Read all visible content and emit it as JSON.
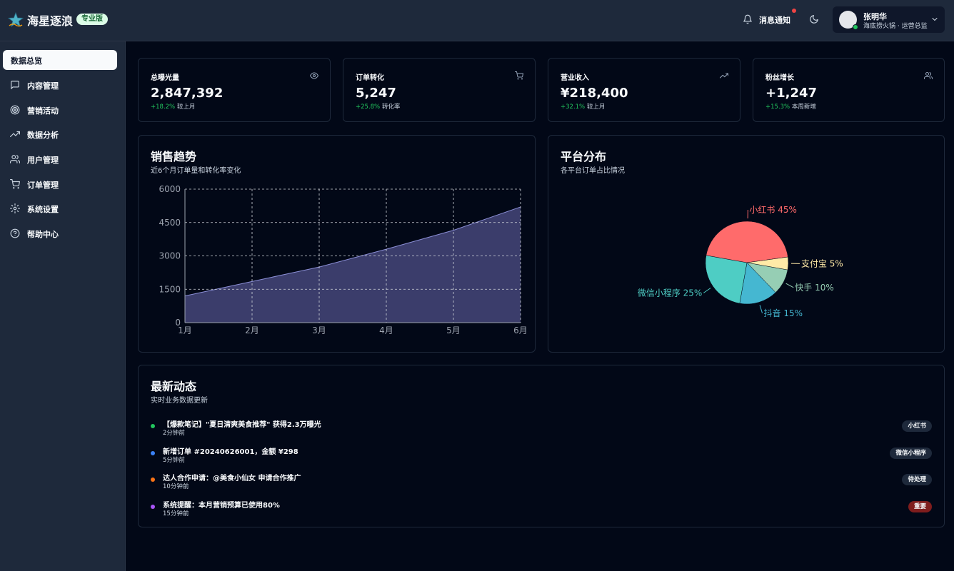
{
  "header": {
    "brand": "海星逐浪",
    "badge": "专业版",
    "notifications_label": "消息通知",
    "user": {
      "name": "张明华",
      "role": "海底捞火锅 · 运营总监"
    }
  },
  "sidebar": {
    "items": [
      {
        "label": "数据总览",
        "icon": "home-icon",
        "active": true
      },
      {
        "label": "内容管理",
        "icon": "message-square-icon"
      },
      {
        "label": "营销活动",
        "icon": "target-icon"
      },
      {
        "label": "数据分析",
        "icon": "trending-up-icon"
      },
      {
        "label": "用户管理",
        "icon": "users-icon"
      },
      {
        "label": "订单管理",
        "icon": "shopping-cart-icon"
      },
      {
        "label": "系统设置",
        "icon": "settings-icon"
      },
      {
        "label": "帮助中心",
        "icon": "help-circle-icon"
      }
    ]
  },
  "stats": [
    {
      "title": "总曝光量",
      "value": "2,847,392",
      "change": "+18.2%",
      "note": "较上月",
      "icon": "eye-icon"
    },
    {
      "title": "订单转化",
      "value": "5,247",
      "change": "+25.8%",
      "note": "转化率",
      "icon": "shopping-cart-icon"
    },
    {
      "title": "营业收入",
      "value": "¥218,400",
      "change": "+32.1%",
      "note": "较上月",
      "icon": "trending-up-icon"
    },
    {
      "title": "粉丝增长",
      "value": "+1,247",
      "change": "+15.3%",
      "note": "本周新增",
      "icon": "users-icon"
    }
  ],
  "sales": {
    "title": "销售趋势",
    "subtitle": "近6个月订单量和转化率变化"
  },
  "platform": {
    "title": "平台分布",
    "subtitle": "各平台订单占比情况"
  },
  "activity": {
    "title": "最新动态",
    "subtitle": "实时业务数据更新",
    "items": [
      {
        "text": "【爆款笔记】\"夏日清爽美食推荐\" 获得2.3万曝光",
        "time": "2分钟前",
        "tag": "小红书",
        "dot_color": "#22c55e"
      },
      {
        "text": "新增订单 #20240626001，金额 ¥298",
        "time": "5分钟前",
        "tag": "微信小程序",
        "dot_color": "#3b82f6"
      },
      {
        "text": "达人合作申请：@美食小仙女 申请合作推广",
        "time": "10分钟前",
        "tag": "待处理",
        "dot_color": "#f97316"
      },
      {
        "text": "系统提醒：本月营销预算已使用80%",
        "time": "15分钟前",
        "tag": "重要",
        "dot_color": "#a855f7",
        "tag_style": "danger"
      }
    ]
  },
  "chart_data": [
    {
      "type": "area",
      "categories": [
        "1月",
        "2月",
        "3月",
        "4月",
        "5月",
        "6月"
      ],
      "series": [
        {
          "values": [
            1200,
            1850,
            2500,
            3300,
            4150,
            5200
          ]
        }
      ],
      "ylim": [
        0,
        6000
      ],
      "yticks": [
        0,
        1500,
        3000,
        4500,
        6000
      ],
      "grid": true,
      "colors": {
        "fill": "#3b3d6b",
        "line": "#8b8fd6"
      }
    },
    {
      "type": "pie",
      "labels": [
        "小红书",
        "支付宝",
        "快手",
        "抖音",
        "微信小程序"
      ],
      "values": [
        45,
        5,
        10,
        15,
        25
      ],
      "colors": [
        "#ff6b6b",
        "#ffeaa7",
        "#96ceb4",
        "#45b7d1",
        "#4ecdc4"
      ]
    }
  ]
}
